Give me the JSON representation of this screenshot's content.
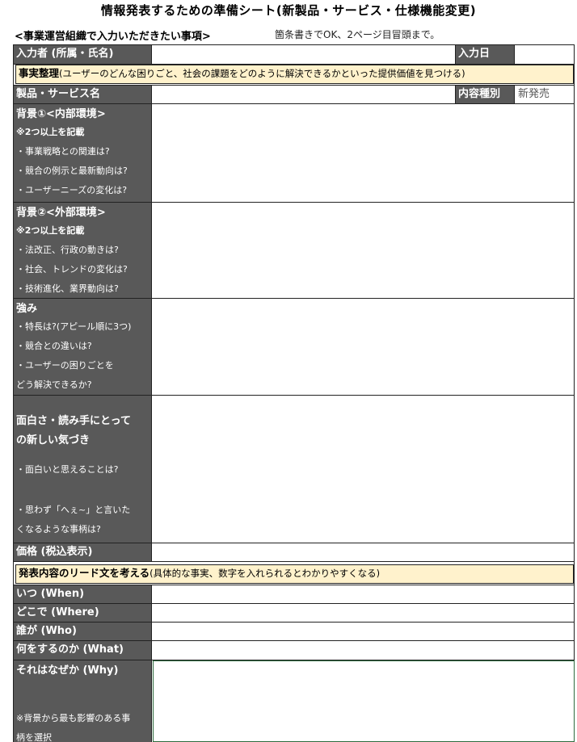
{
  "title": "情報発表するための準備シート(新製品・サービス・仕様機能変更)",
  "subheading": "<事業運営組織で入力いただきたい事項>",
  "note": "箇条書きでOK、2ページ目冒頭まで。",
  "rows": {
    "inputter": {
      "label": "入力者 (所属・氏名)",
      "date_label": "入力日"
    },
    "fact_band": {
      "main": "事実整理",
      "detail": "(ユーザーのどんな困りごと、社会の課題をどのように解決できるかといった提供価値を見つける)"
    },
    "product": {
      "label": "製品・サービス名",
      "type_label": "内容種別",
      "type_value": "新発売"
    },
    "bg_internal": {
      "main": "背景①<内部環境>",
      "req": "※2つ以上を記載",
      "items": [
        "・事業戦略との関連は?",
        "・競合の例示と最新動向は?",
        "・ユーザーニーズの変化は?"
      ]
    },
    "bg_external": {
      "main": "背景②<外部環境>",
      "req": "※2つ以上を記載",
      "items": [
        "・法改正、行政の動きは?",
        "・社会、トレンドの変化は?",
        "・技術進化、業界動向は?"
      ]
    },
    "strengths": {
      "main": "強み",
      "items": [
        "・特長は?(アピール順に3つ)",
        "・競合との違いは?",
        "・ユーザーの困りごとを",
        "どう解決できるか?"
      ]
    },
    "interest": {
      "main1": "面白さ・読み手にとって",
      "main2": "の新しい気づき",
      "item1": "・面白いと思えることは?",
      "item2a": "・思わず「へぇ~」と言いた",
      "item2b": "くなるような事柄は?"
    },
    "price": {
      "label": "価格 (税込表示)"
    },
    "lead_band": {
      "main": "発表内容のリード文を考える",
      "detail": "(具体的な事実、数字を入れられるとわかりやすくなる)"
    },
    "when": {
      "label": "いつ (When)"
    },
    "where": {
      "label": "どこで (Where)"
    },
    "who": {
      "label": "誰が (Who)"
    },
    "what": {
      "label": "何をするのか (What)"
    },
    "why": {
      "label": "それはなぜか (Why)",
      "note1": "※背景から最も影響のある事",
      "note2": "柄を選択"
    }
  }
}
